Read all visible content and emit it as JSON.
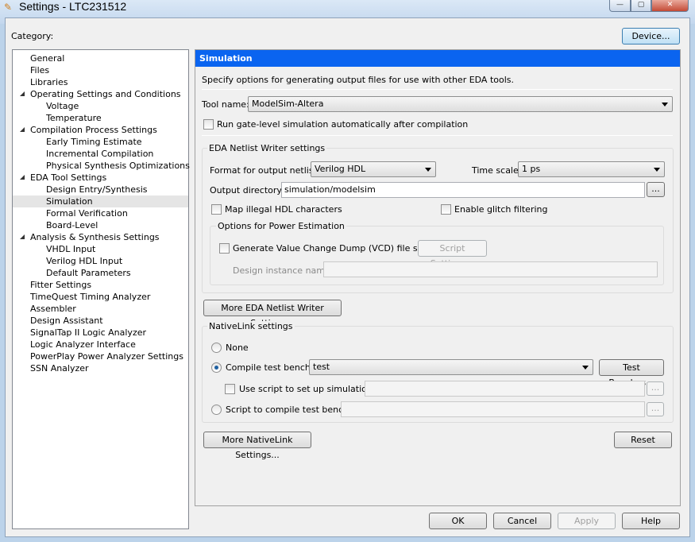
{
  "window": {
    "title": "Settings - LTC231512",
    "minimize": "—",
    "maximize": "▢",
    "close": "✕"
  },
  "category_label": "Category:",
  "device_button": "Device...",
  "tree": [
    {
      "label": "General",
      "level": 0
    },
    {
      "label": "Files",
      "level": 0
    },
    {
      "label": "Libraries",
      "level": 0
    },
    {
      "label": "Operating Settings and Conditions",
      "level": 0,
      "expanded": true
    },
    {
      "label": "Voltage",
      "level": 1
    },
    {
      "label": "Temperature",
      "level": 1
    },
    {
      "label": "Compilation Process Settings",
      "level": 0,
      "expanded": true
    },
    {
      "label": "Early Timing Estimate",
      "level": 1
    },
    {
      "label": "Incremental Compilation",
      "level": 1
    },
    {
      "label": "Physical Synthesis Optimizations",
      "level": 1
    },
    {
      "label": "EDA Tool Settings",
      "level": 0,
      "expanded": true
    },
    {
      "label": "Design Entry/Synthesis",
      "level": 1
    },
    {
      "label": "Simulation",
      "level": 1,
      "selected": true
    },
    {
      "label": "Formal Verification",
      "level": 1
    },
    {
      "label": "Board-Level",
      "level": 1
    },
    {
      "label": "Analysis & Synthesis Settings",
      "level": 0,
      "expanded": true
    },
    {
      "label": "VHDL Input",
      "level": 1
    },
    {
      "label": "Verilog HDL Input",
      "level": 1
    },
    {
      "label": "Default Parameters",
      "level": 1
    },
    {
      "label": "Fitter Settings",
      "level": 0
    },
    {
      "label": "TimeQuest Timing Analyzer",
      "level": 0
    },
    {
      "label": "Assembler",
      "level": 0
    },
    {
      "label": "Design Assistant",
      "level": 0
    },
    {
      "label": "SignalTap II Logic Analyzer",
      "level": 0
    },
    {
      "label": "Logic Analyzer Interface",
      "level": 0
    },
    {
      "label": "PowerPlay Power Analyzer Settings",
      "level": 0
    },
    {
      "label": "SSN Analyzer",
      "level": 0
    }
  ],
  "panel": {
    "title": "Simulation",
    "description": "Specify options for generating output files for use with other EDA tools.",
    "tool_name_label": "Tool name:",
    "tool_name": "ModelSim-Altera",
    "run_gate_level": "Run gate-level simulation automatically after compilation",
    "netlist": {
      "group": "EDA Netlist Writer settings",
      "format_label": "Format for output netlist:",
      "format": "Verilog HDL",
      "timescale_label": "Time scale:",
      "timescale": "1 ps",
      "outdir_label": "Output directory:",
      "outdir": "simulation/modelsim",
      "browse": "...",
      "map_illegal": "Map illegal HDL characters",
      "glitch": "Enable glitch filtering",
      "power_group": "Options for Power Estimation",
      "vcd": "Generate Value Change Dump (VCD) file script",
      "script_settings": "Script Settings...",
      "instance_label": "Design instance name:",
      "instance": ""
    },
    "more_netlist": "More EDA Netlist Writer Settings...",
    "nativelink": {
      "group": "NativeLink settings",
      "none": "None",
      "compile_tb": "Compile test bench:",
      "tb": "test",
      "test_benches": "Test Benches...",
      "use_script": "Use script to set up simulation:",
      "script_value": "",
      "browse": "...",
      "script_compile": "Script to compile test bench:",
      "script_compile_value": ""
    },
    "more_nativelink": "More NativeLink Settings...",
    "reset": "Reset"
  },
  "footer": {
    "ok": "OK",
    "cancel": "Cancel",
    "apply": "Apply",
    "help": "Help"
  },
  "colors": {
    "header": "#0a64f0",
    "selection": "#e5e5e5"
  }
}
